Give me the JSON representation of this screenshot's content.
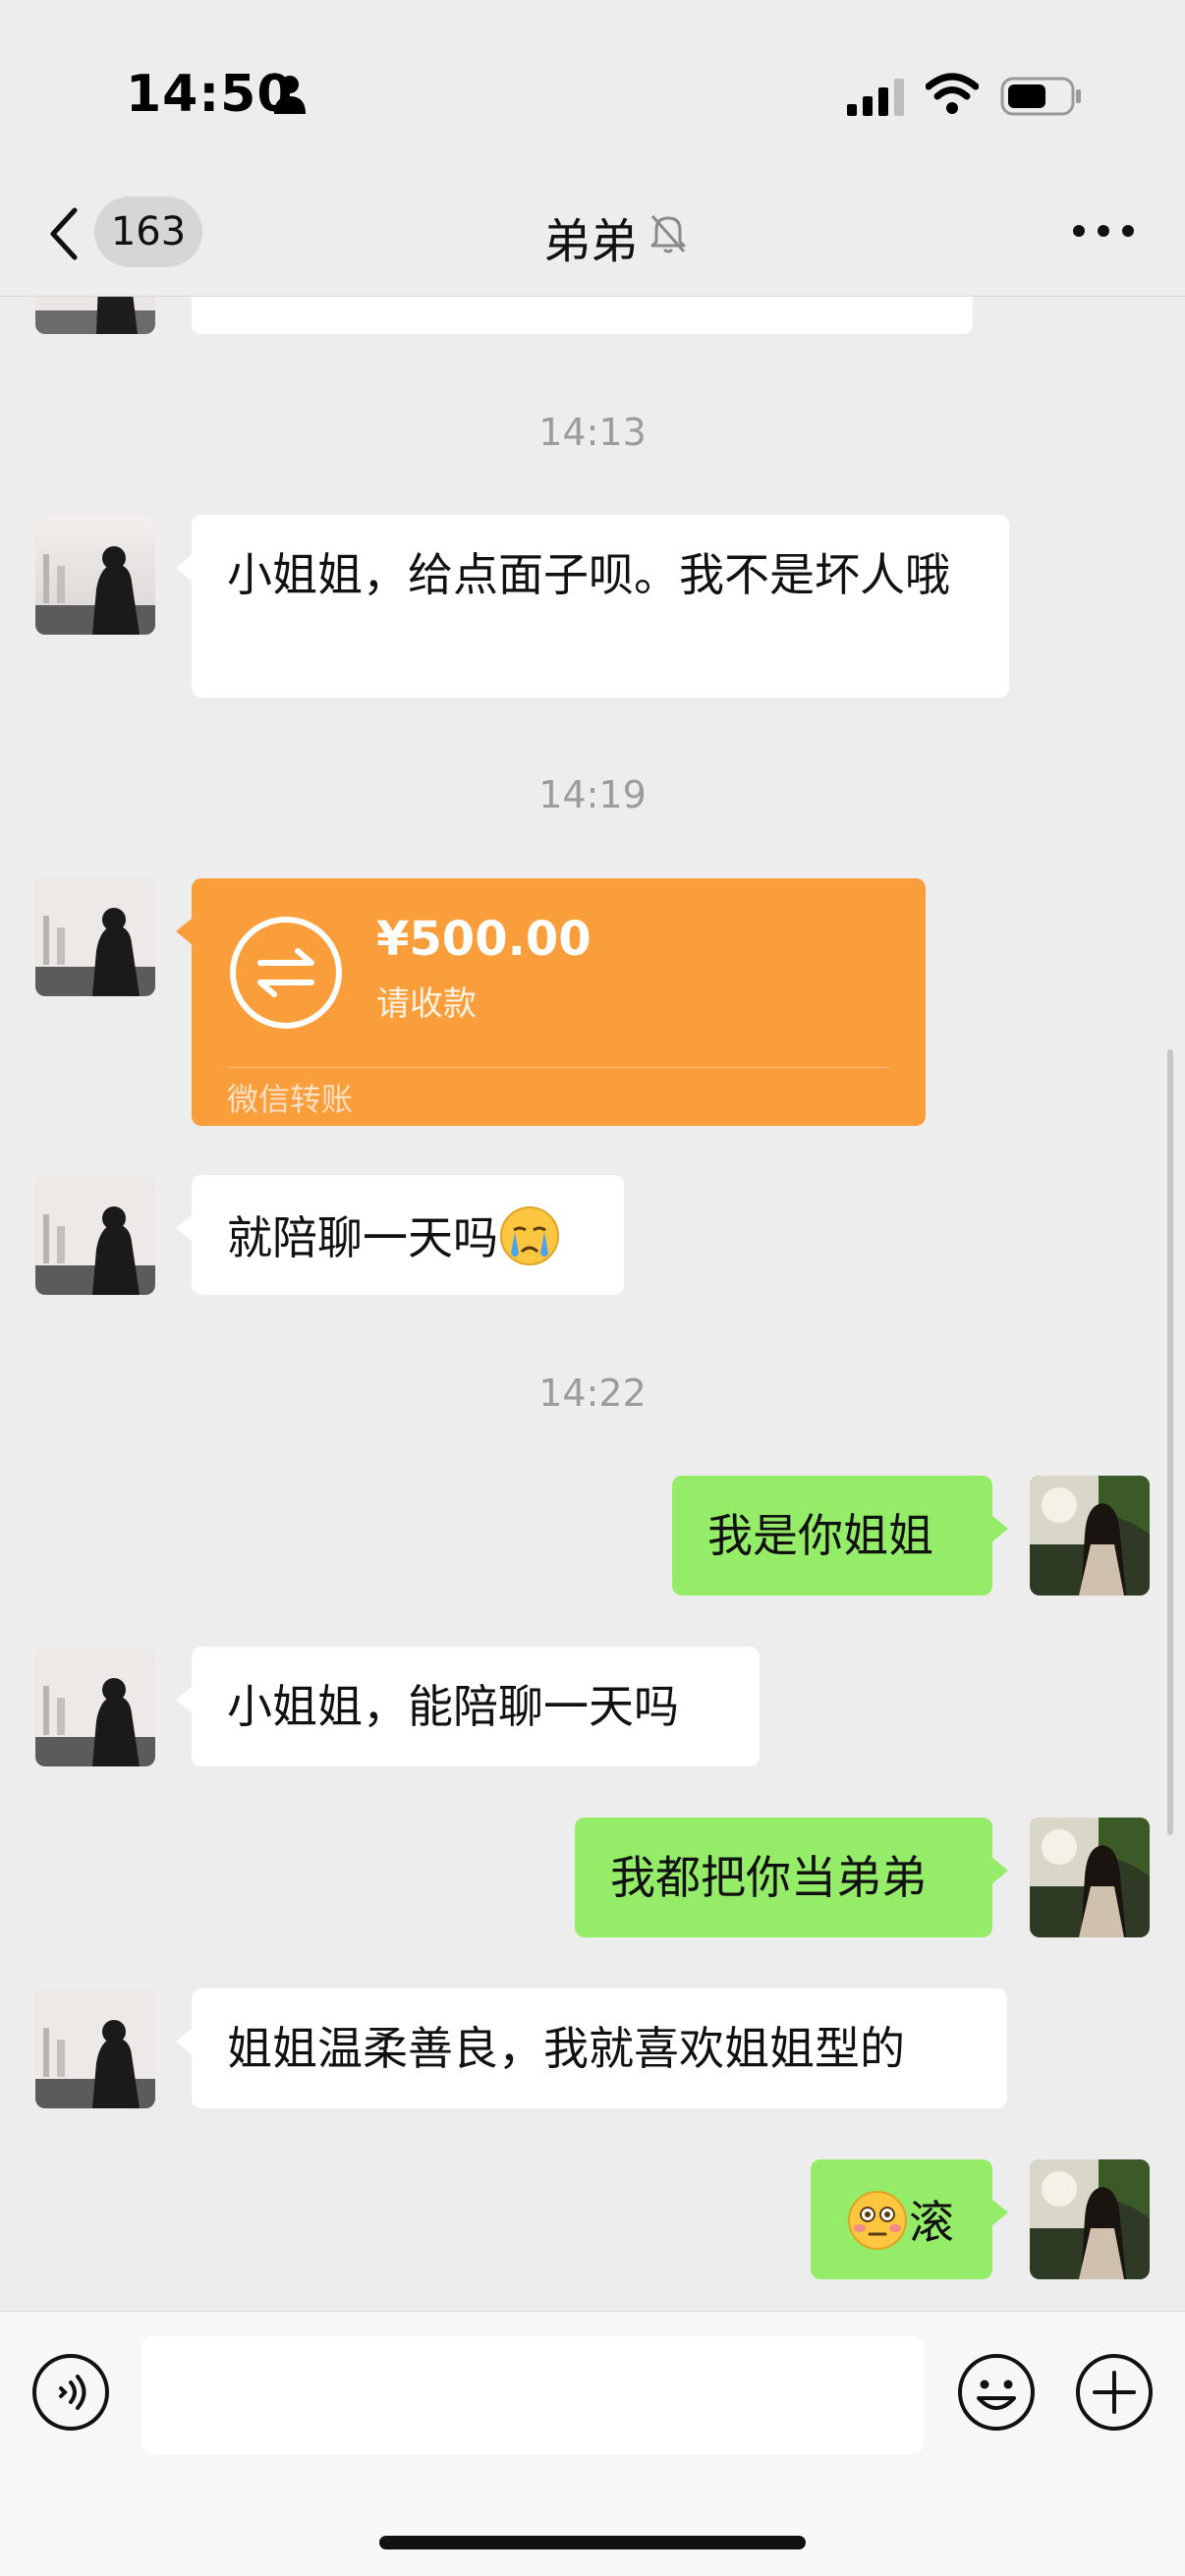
{
  "status_bar": {
    "time": "14:50"
  },
  "nav": {
    "unread_count": "163",
    "title": "弟弟"
  },
  "messages": [
    {
      "type": "time",
      "text": "14:13"
    },
    {
      "type": "in",
      "text": "小姐姐，给点面子呗。我不是坏人哦"
    },
    {
      "type": "time",
      "text": "14:19"
    },
    {
      "type": "transfer",
      "amount": "¥500.00",
      "status": "请收款",
      "label": "微信转账"
    },
    {
      "type": "in",
      "text": "就陪聊一天吗",
      "emoji": "crying-face"
    },
    {
      "type": "time",
      "text": "14:22"
    },
    {
      "type": "out",
      "text": "我是你姐姐"
    },
    {
      "type": "in",
      "text": "小姐姐，能陪聊一天吗"
    },
    {
      "type": "out",
      "text": "我都把你当弟弟"
    },
    {
      "type": "in",
      "text": "姐姐温柔善良，我就喜欢姐姐型的"
    },
    {
      "type": "out",
      "text": "滚",
      "emoji": "flushed-face"
    }
  ],
  "input": {
    "placeholder": ""
  },
  "colors": {
    "incoming_bubble": "#ffffff",
    "outgoing_bubble": "#95ec69",
    "transfer": "#fa9d3b",
    "background": "#ededed"
  }
}
